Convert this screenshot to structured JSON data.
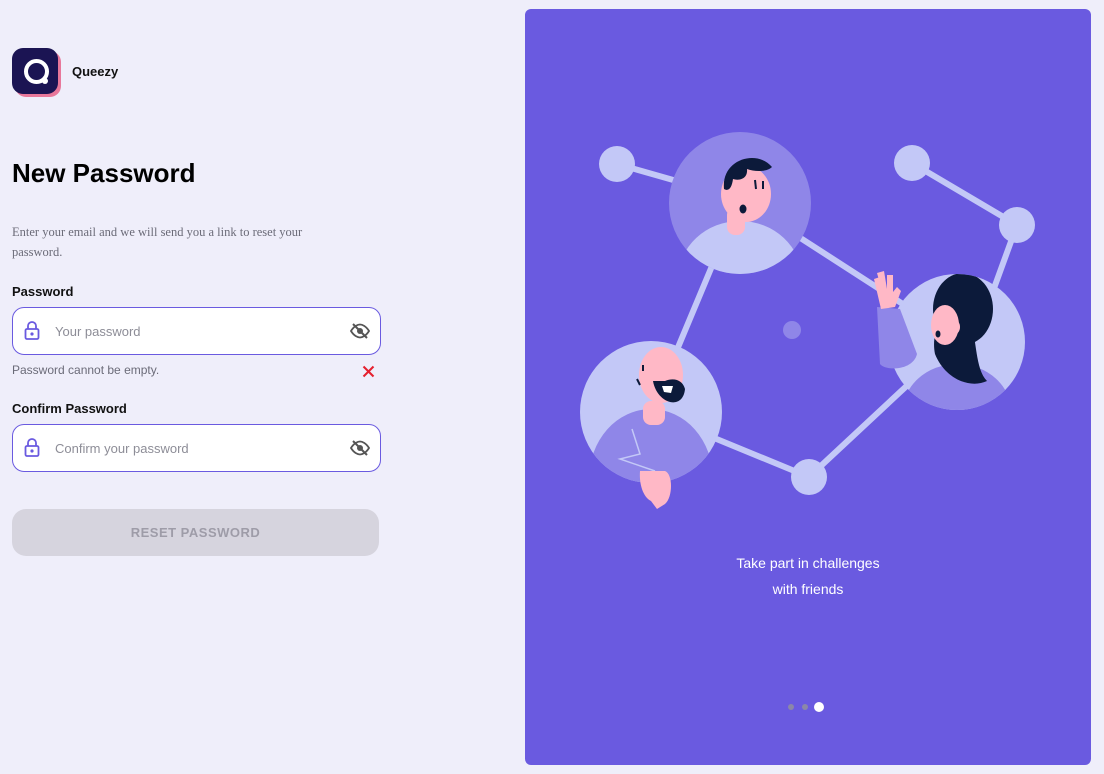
{
  "brand": {
    "name": "Queezy",
    "logo_icon": "q-logo-icon"
  },
  "form": {
    "title": "New Password",
    "description": "Enter your email and we will send you a link to reset your password.",
    "password": {
      "label": "Password",
      "placeholder": "Your password",
      "value": "",
      "error": "Password cannot be empty."
    },
    "confirm": {
      "label": "Confirm Password",
      "placeholder": "Confirm your password",
      "value": ""
    },
    "reset_button": "RESET PASSWORD"
  },
  "hero": {
    "caption_line1": "Take part in challenges",
    "caption_line2": "with friends",
    "carousel": {
      "total": 3,
      "active": 3
    }
  },
  "colors": {
    "accent": "#6a5ae0",
    "background": "#efeefa",
    "error": "#e5202e",
    "button_disabled": "#d6d4de"
  }
}
